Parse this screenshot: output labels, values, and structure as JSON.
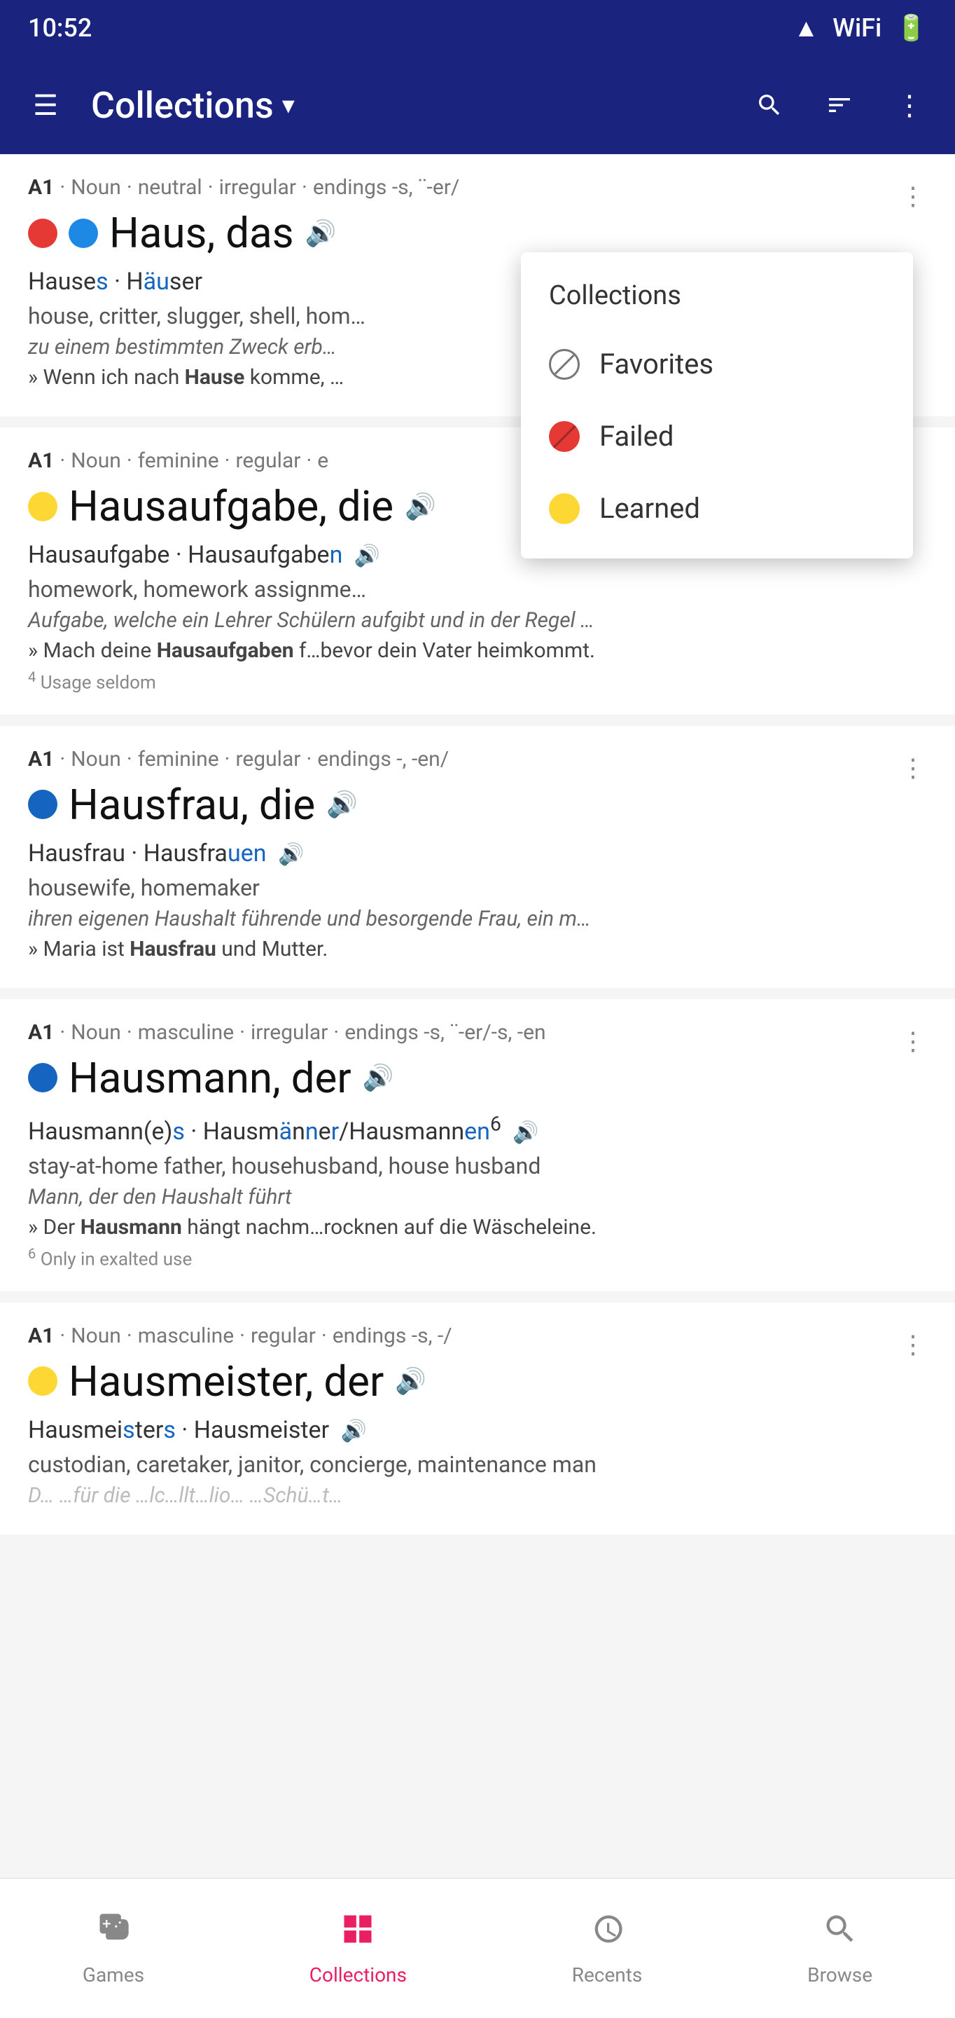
{
  "statusBar": {
    "time": "10:52",
    "icons": [
      "signal",
      "wifi",
      "battery"
    ]
  },
  "appBar": {
    "menuIcon": "☰",
    "title": "Collections",
    "dropdownIcon": "▾",
    "searchIcon": "🔍",
    "filterIcon": "☰",
    "moreIcon": "⋮"
  },
  "dropdown": {
    "header": "Collections",
    "items": [
      {
        "id": "favorites",
        "label": "Favorites",
        "iconType": "slash"
      },
      {
        "id": "failed",
        "label": "Failed",
        "iconType": "slash-red"
      },
      {
        "id": "learned",
        "label": "Learned",
        "iconType": "dot-yellow"
      }
    ]
  },
  "words": [
    {
      "id": "haus",
      "level": "A1",
      "partOfSpeech": "Noun",
      "gender": "neutral",
      "conjugation": "irregular",
      "endings": "endings -s, ¨-er/",
      "dots": [
        "red",
        "blue"
      ],
      "title": "Haus",
      "article": ", das",
      "forms": "Hauses · Häuser",
      "definitions": "house, critter, slugger, shell, hom…",
      "italic": "zu einem bestimmten Zweck erb…",
      "example": "» Wenn ich nach Hause komme, …",
      "hasMore": true,
      "truncated": true
    },
    {
      "id": "hausaufgabe",
      "level": "A1",
      "partOfSpeech": "Noun",
      "gender": "feminine",
      "conjugation": "regular",
      "endings": "e",
      "dots": [
        "yellow"
      ],
      "title": "Hausaufgabe",
      "article": ", die",
      "forms": "Hausaufgabe · Hausaufgaben",
      "definitions": "homework, homework assignme…",
      "italic": "Aufgabe, welche ein Lehrer Schülern aufgibt und in der Regel …",
      "example": "» Mach deine Hausaufgaben f…bevor dein Vater heimkommt.",
      "note": "4 Usage seldom",
      "hasMore": false,
      "truncated": true
    },
    {
      "id": "hausfrau",
      "level": "A1",
      "partOfSpeech": "Noun",
      "gender": "feminine",
      "conjugation": "regular",
      "endings": "endings -, -en/",
      "dots": [
        "blue-filled"
      ],
      "title": "Hausfrau",
      "article": ", die",
      "forms": "Hausfrau · Hausfrauen",
      "definitions": "housewife, homemaker",
      "italic": "ihren eigenen Haushalt führende und besorgende Frau, ein m…",
      "example": "» Maria ist Hausfrau und Mutter.",
      "hasMore": true
    },
    {
      "id": "hausmann",
      "level": "A1",
      "partOfSpeech": "Noun",
      "gender": "masculine",
      "conjugation": "irregular",
      "endings": "endings -s, ¨-er/-s, -en",
      "dots": [
        "blue-filled"
      ],
      "title": "Hausmann",
      "article": ", der",
      "forms": "Hausmann(e)s · Hausmänner/Hausmannen",
      "formsSuperscript": "6",
      "definitions": "stay-at-home father, househusband, house husband",
      "italic": "Mann, der den Haushalt führt",
      "example": "» Der Hausmann hängt nachm…rocknen auf die Wäscheleine.",
      "note": "6 Only in exalted use",
      "hasMore": true
    },
    {
      "id": "hausmeister",
      "level": "A1",
      "partOfSpeech": "Noun",
      "gender": "masculine",
      "conjugation": "regular",
      "endings": "endings -s, -/",
      "dots": [
        "yellow"
      ],
      "title": "Hausmeister",
      "article": ", der",
      "forms": "Hausmeisters · Hausmeister",
      "definitions": "custodian, caretaker, janitor, concierge, maintenance man",
      "italic": "D… …für die …lc…llt…lio… …Schü…t…",
      "hasMore": true,
      "truncated": true
    }
  ],
  "bottomNav": {
    "items": [
      {
        "id": "games",
        "label": "Games",
        "icon": "🎮",
        "active": false
      },
      {
        "id": "collections",
        "label": "Collections",
        "icon": "⊞",
        "active": true
      },
      {
        "id": "recents",
        "label": "Recents",
        "icon": "🕐",
        "active": false
      },
      {
        "id": "browse",
        "label": "Browse",
        "icon": "🔍",
        "active": false
      }
    ]
  }
}
